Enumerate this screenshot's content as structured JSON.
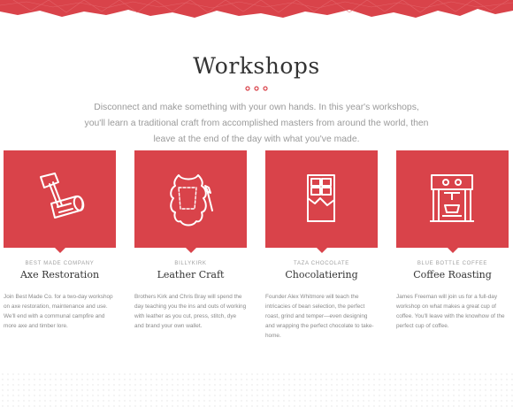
{
  "section": {
    "title": "Workshops",
    "intro": "Disconnect and make something with your own hands. In this year's workshops, you'll learn a traditional craft from accomplished masters from around the world, then leave at the end of the day with what you've made."
  },
  "colors": {
    "accent": "#d9434a",
    "text_dark": "#333333",
    "text_muted": "#9a9a9a"
  },
  "workshops": [
    {
      "company": "BEST MADE COMPANY",
      "name": "Axe Restoration",
      "icon": "axe-log-icon",
      "description": "Join Best Made Co. for a two-day workshop on axe restoration, maintenance and use. We'll end with a communal campfire and more axe and timber lore."
    },
    {
      "company": "BILLYKIRK",
      "name": "Leather Craft",
      "icon": "leather-hide-icon",
      "description": "Brothers Kirk and Chris Bray will spend the day teaching you the ins and outs of working with leather as you cut, press, stitch, dye and brand your own wallet."
    },
    {
      "company": "TAZA CHOCOLATE",
      "name": "Chocolatiering",
      "icon": "chocolate-bar-icon",
      "description": "Founder Alex Whitmore will teach the intricacies of bean selection, the perfect roast, grind and temper—even designing and wrapping the perfect chocolate to take-home."
    },
    {
      "company": "BLUE BOTTLE COFFEE",
      "name": "Coffee Roasting",
      "icon": "espresso-machine-icon",
      "description": "James Freeman will join us for a full-day workshop on what makes a great cup of coffee. You'll leave with the knowhow of the perfect cup of coffee."
    }
  ]
}
